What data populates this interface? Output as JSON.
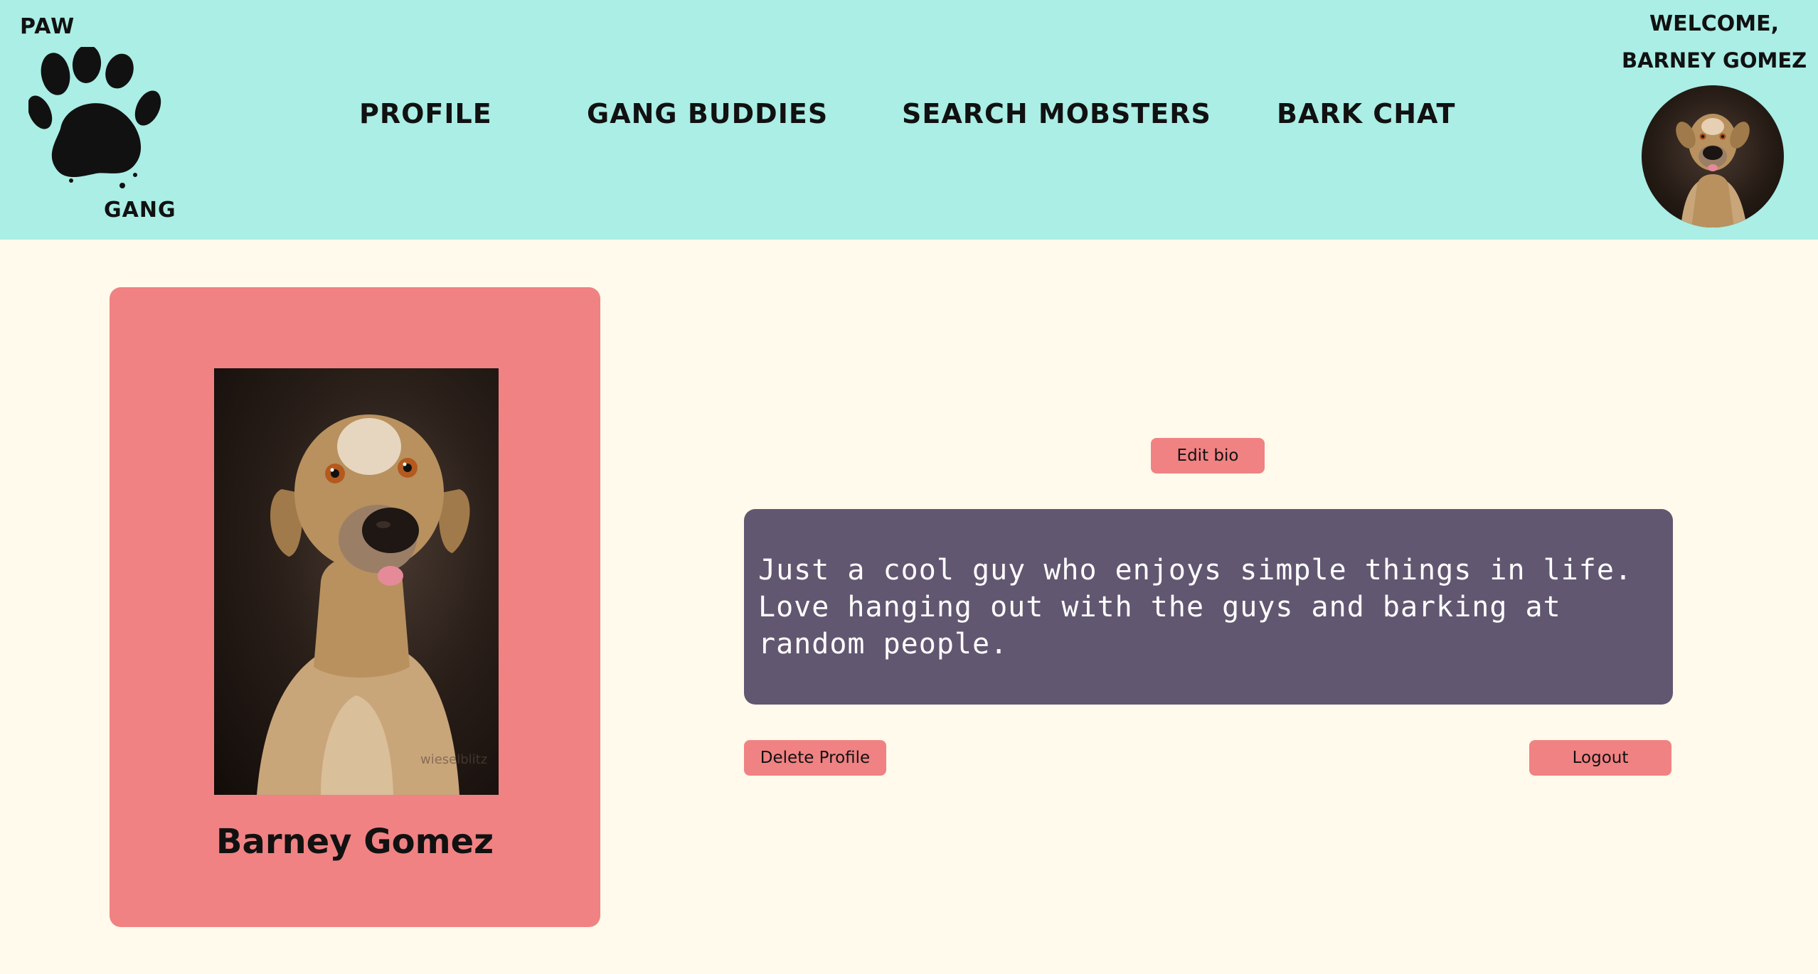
{
  "logo": {
    "top_text": "PAW",
    "bottom_text": "GANG",
    "icon": "paw-print-icon"
  },
  "nav": {
    "items": [
      {
        "label": "PROFILE"
      },
      {
        "label": "GANG BUDDIES"
      },
      {
        "label": "SEARCH MOBSTERS"
      },
      {
        "label": "BARK CHAT"
      }
    ]
  },
  "user": {
    "welcome": "WELCOME,",
    "name_header": "BARNEY GOMEZ",
    "avatar_icon": "dog-avatar-icon"
  },
  "profile": {
    "name": "Barney Gomez",
    "photo_icon": "dog-photo"
  },
  "bio": {
    "edit_label": "Edit bio",
    "text": "Just a cool guy who enjoys simple things in life. Love hanging out with the guys and barking at random people."
  },
  "actions": {
    "delete_label": "Delete Profile",
    "logout_label": "Logout"
  },
  "colors": {
    "header_bg": "#aaeee5",
    "page_bg": "#fffaeb",
    "accent": "#f08283",
    "bio_bg": "#625771"
  }
}
